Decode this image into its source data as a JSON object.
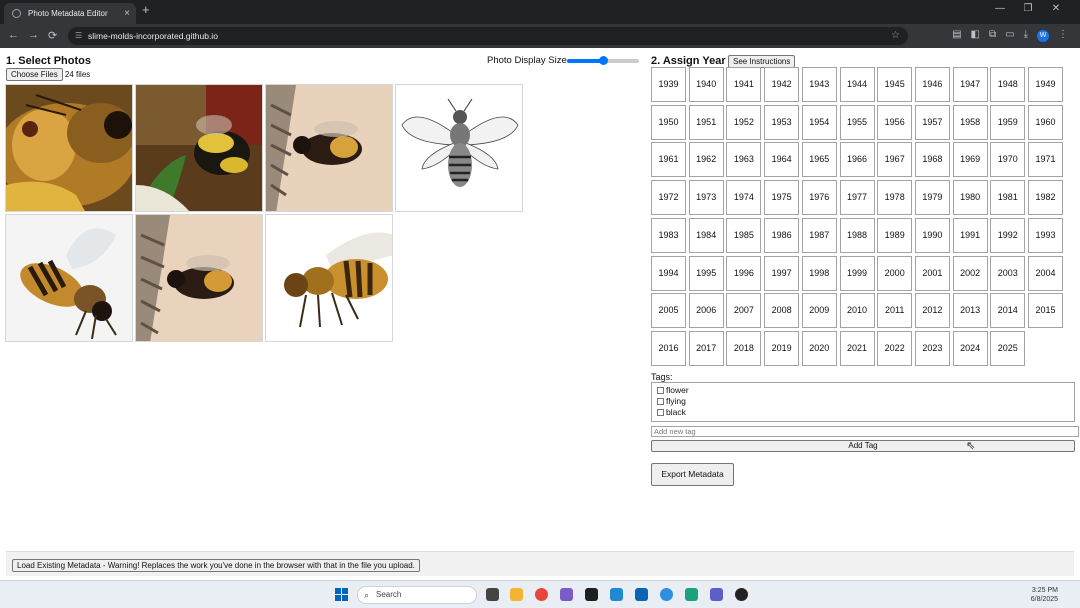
{
  "browser": {
    "tab_title": "Photo Metadata Editor",
    "tab_close": "×",
    "new_tab": "+",
    "url": "slime-molds-incorporated.github.io",
    "back": "←",
    "forward": "→",
    "reload": "⟳"
  },
  "section1": {
    "title": "1. Select Photos",
    "choose_files_label": "Choose Files",
    "files_count": "24 files",
    "display_size_label": "Photo Display Size",
    "display_size_value": 0.5
  },
  "section2": {
    "title": "2. Assign Year",
    "instructions_button": "See Instructions",
    "years": [
      "1939",
      "1940",
      "1941",
      "1942",
      "1943",
      "1944",
      "1945",
      "1946",
      "1947",
      "1948",
      "1949",
      "1950",
      "1951",
      "1952",
      "1953",
      "1954",
      "1955",
      "1956",
      "1957",
      "1958",
      "1959",
      "1960",
      "1961",
      "1962",
      "1963",
      "1964",
      "1965",
      "1966",
      "1967",
      "1968",
      "1969",
      "1970",
      "1971",
      "1972",
      "1973",
      "1974",
      "1975",
      "1976",
      "1977",
      "1978",
      "1979",
      "1980",
      "1981",
      "1982",
      "1983",
      "1984",
      "1985",
      "1986",
      "1987",
      "1988",
      "1989",
      "1990",
      "1991",
      "1992",
      "1993",
      "1994",
      "1995",
      "1996",
      "1997",
      "1998",
      "1999",
      "2000",
      "2001",
      "2002",
      "2003",
      "2004",
      "2005",
      "2006",
      "2007",
      "2008",
      "2009",
      "2010",
      "2011",
      "2012",
      "2013",
      "2014",
      "2015",
      "2016",
      "2017",
      "2018",
      "2019",
      "2020",
      "2021",
      "2022",
      "2023",
      "2024",
      "2025"
    ]
  },
  "tags": {
    "label": "Tags:",
    "items": [
      {
        "label": "flower",
        "checked": false
      },
      {
        "label": "flying",
        "checked": false
      },
      {
        "label": "black",
        "checked": false
      }
    ],
    "new_tag_placeholder": "Add new tag",
    "add_tag_button": "Add Tag"
  },
  "export_button": "Export Metadata",
  "load_button": "Load Existing Metadata - Warning! Replaces the work you've done in the browser with that in the file you upload.",
  "photos": [
    {
      "icon": "bee-closeup-photo"
    },
    {
      "icon": "bumblebee-flying-photo"
    },
    {
      "icon": "bee-on-mesh-photo"
    },
    {
      "icon": "bee-illustration"
    },
    {
      "icon": "honeybee-white-photo"
    },
    {
      "icon": "bee-on-mesh-photo-2"
    },
    {
      "icon": "honeybee-side-photo"
    }
  ],
  "taskbar": {
    "search_placeholder": "Search",
    "time": "3:25 PM",
    "date": "6/8/2025"
  },
  "colors": {
    "accent": "#0075ff",
    "browser_dark": "#202124",
    "browser_mid": "#35363a"
  }
}
